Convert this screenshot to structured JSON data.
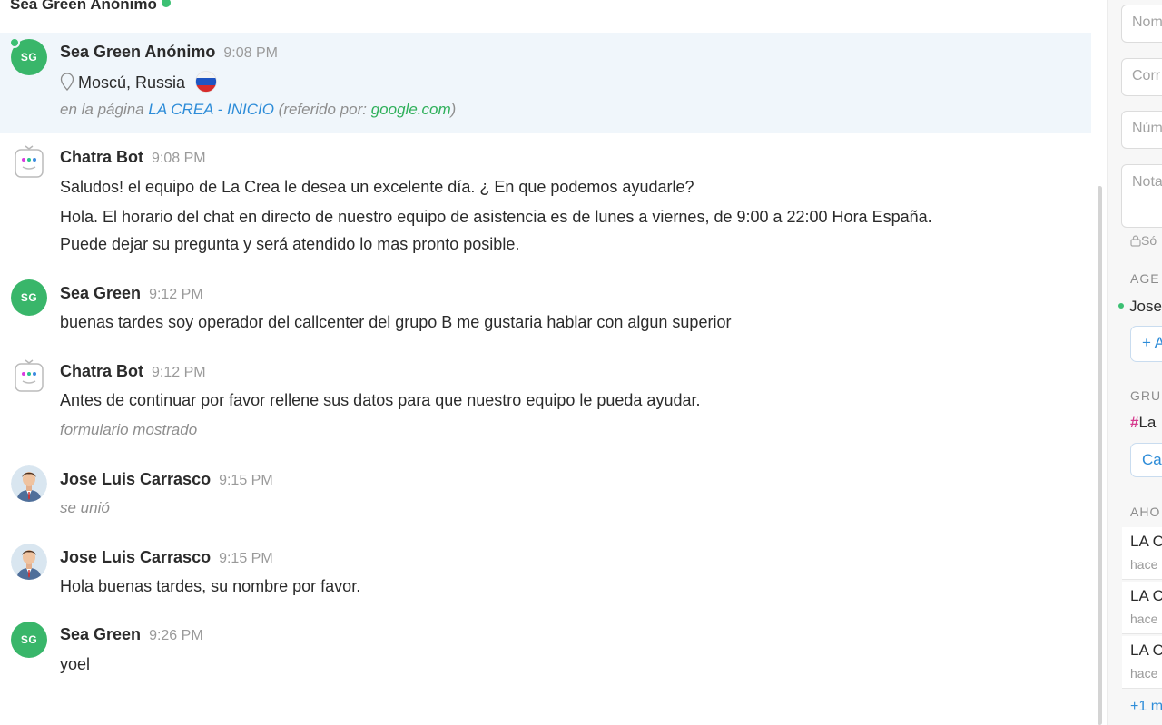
{
  "header": {
    "visitor_name": "Sea Green Anónimo"
  },
  "messages": [
    {
      "author": "Sea Green Anónimo",
      "time": "9:08 PM",
      "avatar_initials": "SG",
      "location": "Moscú, Russia",
      "page_prefix": "en la página",
      "page_link": "LA CREA - INICIO",
      "referrer_prefix": "(referido por:",
      "referrer_link": "google.com",
      "referrer_suffix": ")"
    },
    {
      "author": "Chatra Bot",
      "time": "9:08 PM",
      "lines": [
        "Saludos! el equipo de La Crea le desea un excelente día. ¿ En que podemos ayudarle?",
        "Hola. El horario del chat en directo de nuestro equipo de asistencia es de lunes a viernes, de 9:00 a 22:00 Hora España.",
        "Puede dejar su pregunta y será atendido lo mas pronto posible."
      ]
    },
    {
      "author": "Sea Green",
      "time": "9:12 PM",
      "avatar_initials": "SG",
      "lines": [
        "buenas tardes soy operador del callcenter del grupo B me gustaria hablar con algun superior"
      ]
    },
    {
      "author": "Chatra Bot",
      "time": "9:12 PM",
      "lines": [
        "Antes de continuar por favor rellene sus datos para que nuestro equipo le pueda ayudar."
      ],
      "note": "formulario mostrado"
    },
    {
      "author": "Jose Luis Carrasco",
      "time": "9:15 PM",
      "note": "se unió"
    },
    {
      "author": "Jose Luis Carrasco",
      "time": "9:15 PM",
      "lines": [
        "Hola buenas tardes, su nombre por favor."
      ]
    },
    {
      "author": "Sea Green",
      "time": "9:26 PM",
      "avatar_initials": "SG",
      "lines": [
        "yoel"
      ]
    }
  ],
  "sidebar": {
    "fields": [
      {
        "placeholder": "Nom"
      },
      {
        "placeholder": "Corr"
      },
      {
        "placeholder": "Núm"
      },
      {
        "placeholder": "Nota"
      }
    ],
    "private_note": "Só",
    "agents_heading": "AGE",
    "agent_name": "Jose",
    "add_agent_label": "+ A",
    "groups_heading": "GRU",
    "group_hash": "#",
    "group_name": "La",
    "change_group_label": "Ca",
    "now_heading": "AHO",
    "recent_pages": [
      {
        "title": "LA C",
        "sub": "hace"
      },
      {
        "title": "LA C",
        "sub": "hace"
      },
      {
        "title": "LA C",
        "sub": "hace"
      }
    ],
    "more_link": "+1 m"
  },
  "colors": {
    "accent_blue": "#2d8cd8",
    "online_green": "#3cc073",
    "avatar_green": "#39b66a",
    "highlight_bg": "#f0f6fb"
  }
}
